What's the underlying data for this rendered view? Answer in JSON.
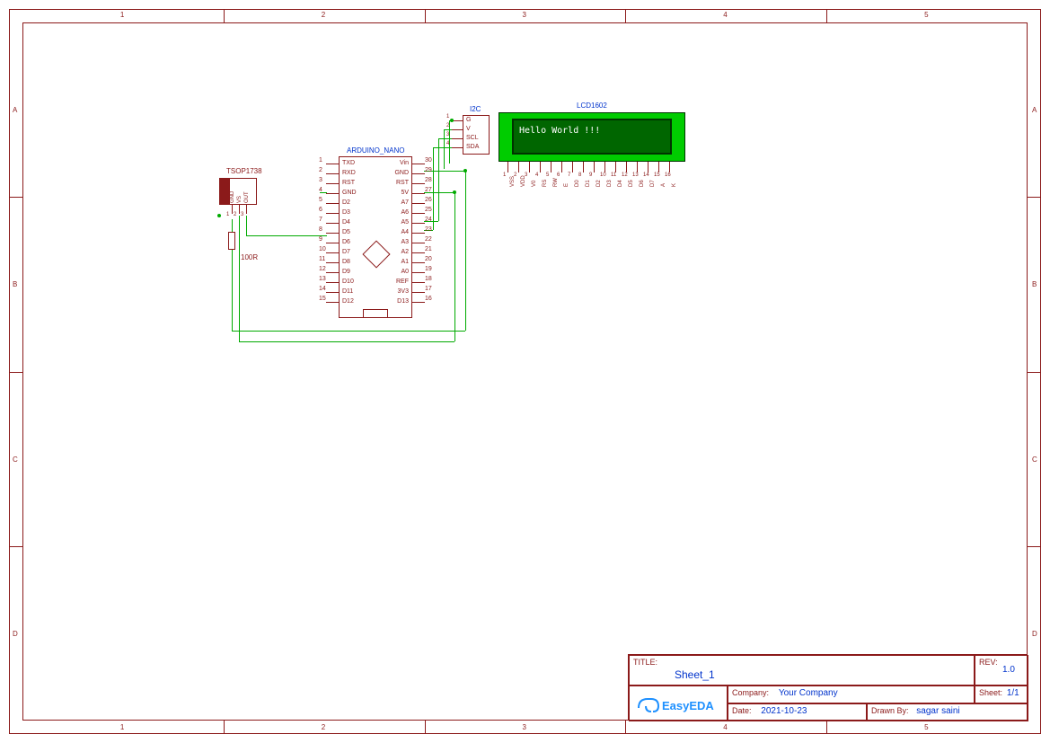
{
  "frame": {
    "cols": [
      "1",
      "2",
      "3",
      "4",
      "5"
    ],
    "rows": [
      "A",
      "B",
      "C",
      "D"
    ]
  },
  "tsop": {
    "name": "TSOP1738",
    "pins": [
      "GND",
      "VS",
      "OUT"
    ],
    "pin_nums": [
      "1",
      "2",
      "3"
    ]
  },
  "resistor": {
    "value": "100R"
  },
  "arduino": {
    "name": "ARDUINO_NANO",
    "left_pins": [
      "TXD",
      "RXD",
      "RST",
      "GND",
      "D2",
      "D3",
      "D4",
      "D5",
      "D6",
      "D7",
      "D8",
      "D9",
      "D10",
      "D11",
      "D12"
    ],
    "left_nums": [
      "1",
      "2",
      "3",
      "4",
      "5",
      "6",
      "7",
      "8",
      "9",
      "10",
      "11",
      "12",
      "13",
      "14",
      "15"
    ],
    "right_pins": [
      "Vin",
      "GND",
      "RST",
      "5V",
      "A7",
      "A6",
      "A5",
      "A4",
      "A3",
      "A2",
      "A1",
      "A0",
      "REF",
      "3V3",
      "D13"
    ],
    "right_nums": [
      "30",
      "29",
      "28",
      "27",
      "26",
      "25",
      "24",
      "23",
      "22",
      "21",
      "20",
      "19",
      "18",
      "17",
      "16"
    ]
  },
  "i2c": {
    "name": "I2C",
    "pins": [
      "G",
      "V",
      "SCL",
      "SDA"
    ],
    "pin_nums": [
      "1",
      "2",
      "3",
      "4"
    ]
  },
  "lcd": {
    "name": "LCD1602",
    "text": "Hello World !!!",
    "pin_names": [
      "VSS",
      "VDD",
      "V0",
      "RS",
      "RW",
      "E",
      "D0",
      "D1",
      "D2",
      "D3",
      "D4",
      "D5",
      "D6",
      "D7",
      "A",
      "K"
    ],
    "pin_nums": [
      "1",
      "2",
      "3",
      "4",
      "5",
      "6",
      "7",
      "8",
      "9",
      "10",
      "11",
      "12",
      "13",
      "14",
      "15",
      "16"
    ]
  },
  "titleblock": {
    "title_label": "TITLE:",
    "title_value": "Sheet_1",
    "rev_label": "REV:",
    "rev_value": "1.0",
    "company_label": "Company:",
    "company_value": "Your Company",
    "sheet_label": "Sheet:",
    "sheet_value": "1/1",
    "date_label": "Date:",
    "date_value": "2021-10-23",
    "drawn_label": "Drawn By:",
    "drawn_value": "sagar saini",
    "logo": "EasyEDA"
  }
}
